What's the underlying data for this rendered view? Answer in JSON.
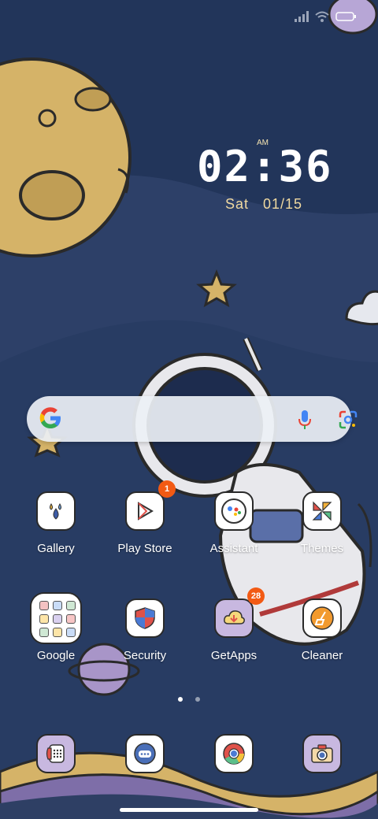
{
  "status_bar": {
    "icons": [
      "signal-icon",
      "wifi-icon",
      "battery-icon"
    ]
  },
  "clock": {
    "ampm": "AM",
    "time": "02:36",
    "date": "Sat   01/15"
  },
  "search_bar": {
    "icons": [
      "google-logo-icon",
      "microphone-icon",
      "google-lens-icon"
    ]
  },
  "apps": [
    {
      "label": "Gallery",
      "icon": "gallery-icon"
    },
    {
      "label": "Play Store",
      "icon": "play-store-icon",
      "badge": "1"
    },
    {
      "label": "Assistant",
      "icon": "assistant-icon"
    },
    {
      "label": "Themes",
      "icon": "themes-icon"
    },
    {
      "label": "Google",
      "icon": "google-folder-icon"
    },
    {
      "label": "Security",
      "icon": "security-icon"
    },
    {
      "label": "GetApps",
      "icon": "getapps-icon",
      "badge": "28"
    },
    {
      "label": "Cleaner",
      "icon": "cleaner-icon"
    }
  ],
  "dock": [
    {
      "icon": "phone-icon"
    },
    {
      "icon": "messages-icon"
    },
    {
      "icon": "chrome-icon"
    },
    {
      "icon": "camera-icon"
    }
  ],
  "page_indicator": {
    "pages": 2,
    "current": 1
  },
  "colors": {
    "sky": "#243656",
    "moon": "#d6b46a",
    "badge": "#f25a14",
    "accent_lilac": "#b7a6d6"
  }
}
